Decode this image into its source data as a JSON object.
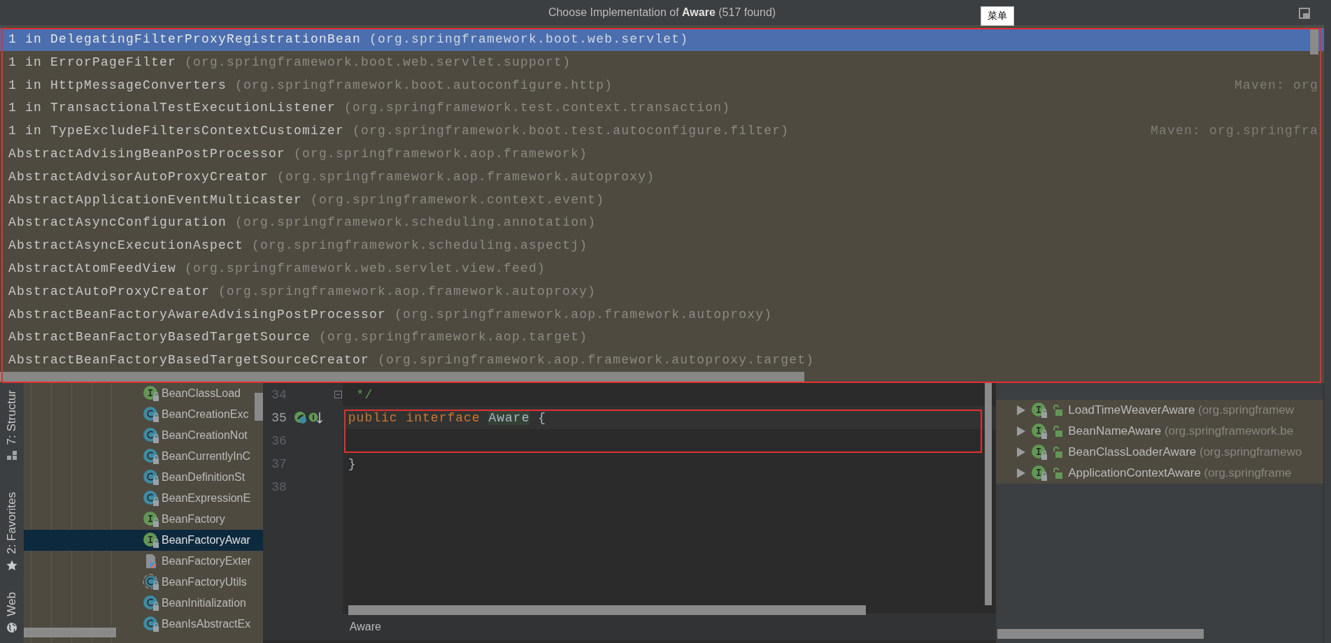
{
  "popup": {
    "title": "Choose Implementation of **Aware** (517 found)",
    "tooltip": "菜单",
    "items": [
      {
        "name": "1 in DelegatingFilterProxyRegistrationBean",
        "package": "(org.springframework.boot.web.servlet)",
        "selected": true
      },
      {
        "name": "1 in ErrorPageFilter",
        "package": "(org.springframework.boot.web.servlet.support)",
        "selected": false
      },
      {
        "name": "1 in HttpMessageConverters",
        "package": "(org.springframework.boot.autoconfigure.http)",
        "location": "Maven: org",
        "selected": false
      },
      {
        "name": "1 in TransactionalTestExecutionListener",
        "package": "(org.springframework.test.context.transaction)",
        "selected": false
      },
      {
        "name": "1 in TypeExcludeFiltersContextCustomizer",
        "package": "(org.springframework.boot.test.autoconfigure.filter)",
        "location": "Maven: org.springfra",
        "selected": false
      },
      {
        "name": "AbstractAdvisingBeanPostProcessor",
        "package": "(org.springframework.aop.framework)",
        "selected": false
      },
      {
        "name": "AbstractAdvisorAutoProxyCreator",
        "package": "(org.springframework.aop.framework.autoproxy)",
        "selected": false
      },
      {
        "name": "AbstractApplicationEventMulticaster",
        "package": "(org.springframework.context.event)",
        "selected": false
      },
      {
        "name": "AbstractAsyncConfiguration",
        "package": "(org.springframework.scheduling.annotation)",
        "selected": false
      },
      {
        "name": "AbstractAsyncExecutionAspect",
        "package": "(org.springframework.scheduling.aspectj)",
        "selected": false
      },
      {
        "name": "AbstractAtomFeedView",
        "package": "(org.springframework.web.servlet.view.feed)",
        "selected": false
      },
      {
        "name": "AbstractAutoProxyCreator",
        "package": "(org.springframework.aop.framework.autoproxy)",
        "selected": false
      },
      {
        "name": "AbstractBeanFactoryAwareAdvisingPostProcessor",
        "package": "(org.springframework.aop.framework.autoproxy)",
        "selected": false
      },
      {
        "name": "AbstractBeanFactoryBasedTargetSource",
        "package": "(org.springframework.aop.target)",
        "selected": false
      },
      {
        "name": "AbstractBeanFactoryBasedTargetSourceCreator",
        "package": "(org.springframework.aop.framework.autoproxy.target)",
        "selected": false
      }
    ]
  },
  "tool_windows": [
    {
      "label": "7: Structur"
    },
    {
      "label": "2: Favorites"
    },
    {
      "label": "Web"
    }
  ],
  "project_tree": [
    {
      "name": "BeanClassLoad",
      "kind": "interface",
      "selected": false
    },
    {
      "name": "BeanCreationExc",
      "kind": "class",
      "selected": false
    },
    {
      "name": "BeanCreationNot",
      "kind": "class",
      "selected": false
    },
    {
      "name": "BeanCurrentlyInC",
      "kind": "class",
      "selected": false
    },
    {
      "name": "BeanDefinitionSt",
      "kind": "class",
      "selected": false
    },
    {
      "name": "BeanExpressionE",
      "kind": "class",
      "selected": false
    },
    {
      "name": "BeanFactory",
      "kind": "interface",
      "selected": false
    },
    {
      "name": "BeanFactoryAwar",
      "kind": "interface",
      "selected": true
    },
    {
      "name": "BeanFactoryExter",
      "kind": "file",
      "selected": false
    },
    {
      "name": "BeanFactoryUtils",
      "kind": "abstract",
      "selected": false
    },
    {
      "name": "BeanInitialization",
      "kind": "class",
      "selected": false
    },
    {
      "name": "BeanIsAbstractEx",
      "kind": "class",
      "selected": false
    }
  ],
  "editor": {
    "lines": [
      {
        "number": "34",
        "current": false,
        "foldable": true,
        "tokens": [
          {
            "text": " */",
            "kind": "comment"
          }
        ]
      },
      {
        "number": "35",
        "current": true,
        "gutter_icons": true,
        "tokens": [
          {
            "text": "public",
            "kind": "keyword"
          },
          {
            "text": "interface",
            "kind": "keyword"
          },
          {
            "text": "Aware",
            "kind": "highlighted"
          },
          {
            "text": "{",
            "kind": "plain"
          }
        ]
      },
      {
        "number": "36",
        "current": false
      },
      {
        "number": "37",
        "current": false,
        "tokens": [
          {
            "text": "}",
            "kind": "plain"
          }
        ]
      },
      {
        "number": "38",
        "current": false
      }
    ],
    "breadcrumb": "Aware"
  },
  "hierarchy": [
    {
      "name": "LoadTimeWeaverAware",
      "package": "(org.springframew"
    },
    {
      "name": "BeanNameAware",
      "package": "(org.springframework.be"
    },
    {
      "name": "BeanClassLoaderAware",
      "package": "(org.springframewo"
    },
    {
      "name": "ApplicationContextAware",
      "package": "(org.springframe"
    }
  ]
}
